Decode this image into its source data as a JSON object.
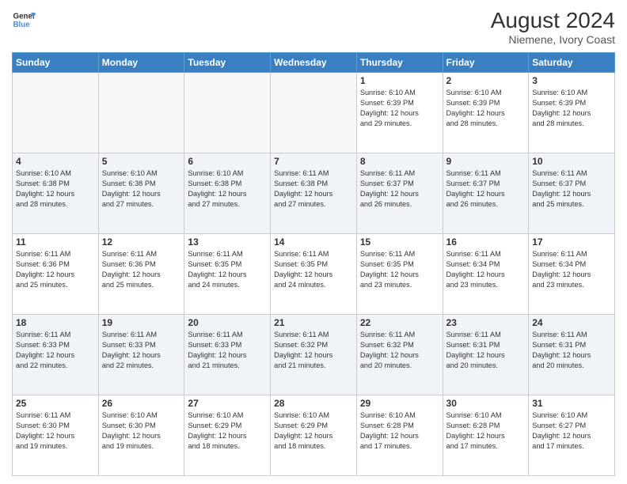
{
  "header": {
    "logo_line1": "General",
    "logo_line2": "Blue",
    "month_year": "August 2024",
    "location": "Niemene, Ivory Coast"
  },
  "weekdays": [
    "Sunday",
    "Monday",
    "Tuesday",
    "Wednesday",
    "Thursday",
    "Friday",
    "Saturday"
  ],
  "weeks": [
    [
      {
        "day": "",
        "text": "",
        "empty": true
      },
      {
        "day": "",
        "text": "",
        "empty": true
      },
      {
        "day": "",
        "text": "",
        "empty": true
      },
      {
        "day": "",
        "text": "",
        "empty": true
      },
      {
        "day": "1",
        "text": "Sunrise: 6:10 AM\nSunset: 6:39 PM\nDaylight: 12 hours\nand 29 minutes."
      },
      {
        "day": "2",
        "text": "Sunrise: 6:10 AM\nSunset: 6:39 PM\nDaylight: 12 hours\nand 28 minutes."
      },
      {
        "day": "3",
        "text": "Sunrise: 6:10 AM\nSunset: 6:39 PM\nDaylight: 12 hours\nand 28 minutes."
      }
    ],
    [
      {
        "day": "4",
        "text": "Sunrise: 6:10 AM\nSunset: 6:38 PM\nDaylight: 12 hours\nand 28 minutes."
      },
      {
        "day": "5",
        "text": "Sunrise: 6:10 AM\nSunset: 6:38 PM\nDaylight: 12 hours\nand 27 minutes."
      },
      {
        "day": "6",
        "text": "Sunrise: 6:10 AM\nSunset: 6:38 PM\nDaylight: 12 hours\nand 27 minutes."
      },
      {
        "day": "7",
        "text": "Sunrise: 6:11 AM\nSunset: 6:38 PM\nDaylight: 12 hours\nand 27 minutes."
      },
      {
        "day": "8",
        "text": "Sunrise: 6:11 AM\nSunset: 6:37 PM\nDaylight: 12 hours\nand 26 minutes."
      },
      {
        "day": "9",
        "text": "Sunrise: 6:11 AM\nSunset: 6:37 PM\nDaylight: 12 hours\nand 26 minutes."
      },
      {
        "day": "10",
        "text": "Sunrise: 6:11 AM\nSunset: 6:37 PM\nDaylight: 12 hours\nand 25 minutes."
      }
    ],
    [
      {
        "day": "11",
        "text": "Sunrise: 6:11 AM\nSunset: 6:36 PM\nDaylight: 12 hours\nand 25 minutes."
      },
      {
        "day": "12",
        "text": "Sunrise: 6:11 AM\nSunset: 6:36 PM\nDaylight: 12 hours\nand 25 minutes."
      },
      {
        "day": "13",
        "text": "Sunrise: 6:11 AM\nSunset: 6:35 PM\nDaylight: 12 hours\nand 24 minutes."
      },
      {
        "day": "14",
        "text": "Sunrise: 6:11 AM\nSunset: 6:35 PM\nDaylight: 12 hours\nand 24 minutes."
      },
      {
        "day": "15",
        "text": "Sunrise: 6:11 AM\nSunset: 6:35 PM\nDaylight: 12 hours\nand 23 minutes."
      },
      {
        "day": "16",
        "text": "Sunrise: 6:11 AM\nSunset: 6:34 PM\nDaylight: 12 hours\nand 23 minutes."
      },
      {
        "day": "17",
        "text": "Sunrise: 6:11 AM\nSunset: 6:34 PM\nDaylight: 12 hours\nand 23 minutes."
      }
    ],
    [
      {
        "day": "18",
        "text": "Sunrise: 6:11 AM\nSunset: 6:33 PM\nDaylight: 12 hours\nand 22 minutes."
      },
      {
        "day": "19",
        "text": "Sunrise: 6:11 AM\nSunset: 6:33 PM\nDaylight: 12 hours\nand 22 minutes."
      },
      {
        "day": "20",
        "text": "Sunrise: 6:11 AM\nSunset: 6:33 PM\nDaylight: 12 hours\nand 21 minutes."
      },
      {
        "day": "21",
        "text": "Sunrise: 6:11 AM\nSunset: 6:32 PM\nDaylight: 12 hours\nand 21 minutes."
      },
      {
        "day": "22",
        "text": "Sunrise: 6:11 AM\nSunset: 6:32 PM\nDaylight: 12 hours\nand 20 minutes."
      },
      {
        "day": "23",
        "text": "Sunrise: 6:11 AM\nSunset: 6:31 PM\nDaylight: 12 hours\nand 20 minutes."
      },
      {
        "day": "24",
        "text": "Sunrise: 6:11 AM\nSunset: 6:31 PM\nDaylight: 12 hours\nand 20 minutes."
      }
    ],
    [
      {
        "day": "25",
        "text": "Sunrise: 6:11 AM\nSunset: 6:30 PM\nDaylight: 12 hours\nand 19 minutes."
      },
      {
        "day": "26",
        "text": "Sunrise: 6:10 AM\nSunset: 6:30 PM\nDaylight: 12 hours\nand 19 minutes."
      },
      {
        "day": "27",
        "text": "Sunrise: 6:10 AM\nSunset: 6:29 PM\nDaylight: 12 hours\nand 18 minutes."
      },
      {
        "day": "28",
        "text": "Sunrise: 6:10 AM\nSunset: 6:29 PM\nDaylight: 12 hours\nand 18 minutes."
      },
      {
        "day": "29",
        "text": "Sunrise: 6:10 AM\nSunset: 6:28 PM\nDaylight: 12 hours\nand 17 minutes."
      },
      {
        "day": "30",
        "text": "Sunrise: 6:10 AM\nSunset: 6:28 PM\nDaylight: 12 hours\nand 17 minutes."
      },
      {
        "day": "31",
        "text": "Sunrise: 6:10 AM\nSunset: 6:27 PM\nDaylight: 12 hours\nand 17 minutes."
      }
    ]
  ]
}
